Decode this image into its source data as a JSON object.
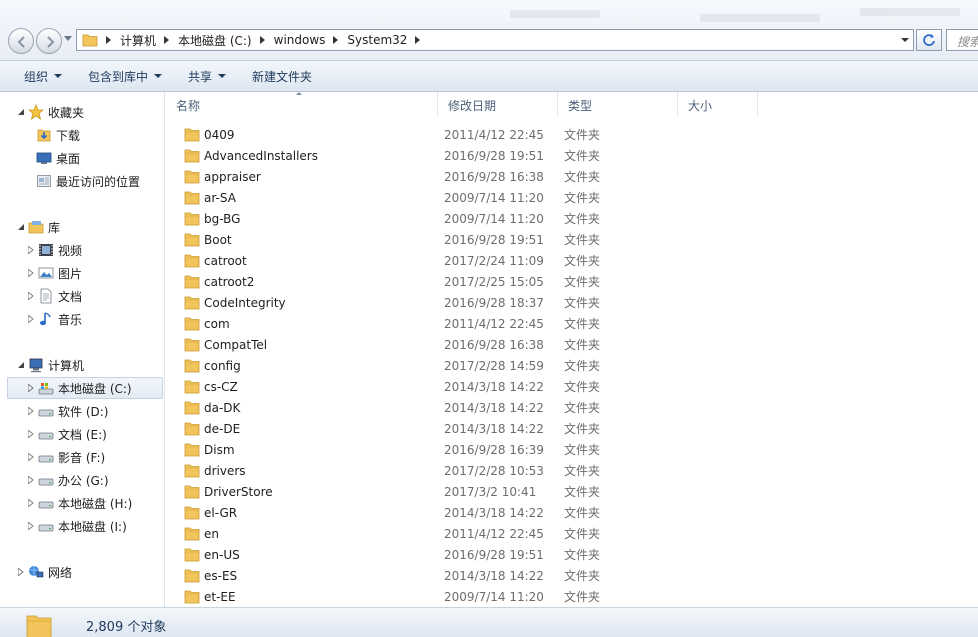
{
  "address": {
    "crumbs": [
      "计算机",
      "本地磁盘 (C:)",
      "windows",
      "System32"
    ],
    "search_placeholder": "搜索"
  },
  "toolbar": {
    "organize": "组织",
    "include": "包含到库中",
    "share": "共享",
    "new_folder": "新建文件夹"
  },
  "nav": {
    "favorites": "收藏夹",
    "downloads": "下载",
    "desktop": "桌面",
    "recent": "最近访问的位置",
    "libraries": "库",
    "videos": "视频",
    "pictures": "图片",
    "documents": "文档",
    "music": "音乐",
    "computer": "计算机",
    "drives": [
      "本地磁盘 (C:)",
      "软件 (D:)",
      "文档 (E:)",
      "影音 (F:)",
      "办公 (G:)",
      "本地磁盘 (H:)",
      "本地磁盘 (I:)"
    ],
    "network": "网络"
  },
  "columns": {
    "name": "名称",
    "date": "修改日期",
    "type": "类型",
    "size": "大小"
  },
  "files": [
    {
      "name": "0409",
      "date": "2011/4/12 22:45",
      "type": "文件夹"
    },
    {
      "name": "AdvancedInstallers",
      "date": "2016/9/28 19:51",
      "type": "文件夹"
    },
    {
      "name": "appraiser",
      "date": "2016/9/28 16:38",
      "type": "文件夹"
    },
    {
      "name": "ar-SA",
      "date": "2009/7/14 11:20",
      "type": "文件夹"
    },
    {
      "name": "bg-BG",
      "date": "2009/7/14 11:20",
      "type": "文件夹"
    },
    {
      "name": "Boot",
      "date": "2016/9/28 19:51",
      "type": "文件夹"
    },
    {
      "name": "catroot",
      "date": "2017/2/24 11:09",
      "type": "文件夹"
    },
    {
      "name": "catroot2",
      "date": "2017/2/25 15:05",
      "type": "文件夹"
    },
    {
      "name": "CodeIntegrity",
      "date": "2016/9/28 18:37",
      "type": "文件夹"
    },
    {
      "name": "com",
      "date": "2011/4/12 22:45",
      "type": "文件夹"
    },
    {
      "name": "CompatTel",
      "date": "2016/9/28 16:38",
      "type": "文件夹"
    },
    {
      "name": "config",
      "date": "2017/2/28 14:59",
      "type": "文件夹"
    },
    {
      "name": "cs-CZ",
      "date": "2014/3/18 14:22",
      "type": "文件夹"
    },
    {
      "name": "da-DK",
      "date": "2014/3/18 14:22",
      "type": "文件夹"
    },
    {
      "name": "de-DE",
      "date": "2014/3/18 14:22",
      "type": "文件夹"
    },
    {
      "name": "Dism",
      "date": "2016/9/28 16:39",
      "type": "文件夹"
    },
    {
      "name": "drivers",
      "date": "2017/2/28 10:53",
      "type": "文件夹"
    },
    {
      "name": "DriverStore",
      "date": "2017/3/2 10:41",
      "type": "文件夹"
    },
    {
      "name": "el-GR",
      "date": "2014/3/18 14:22",
      "type": "文件夹"
    },
    {
      "name": "en",
      "date": "2011/4/12 22:45",
      "type": "文件夹"
    },
    {
      "name": "en-US",
      "date": "2016/9/28 19:51",
      "type": "文件夹"
    },
    {
      "name": "es-ES",
      "date": "2014/3/18 14:22",
      "type": "文件夹"
    },
    {
      "name": "et-EE",
      "date": "2009/7/14 11:20",
      "type": "文件夹"
    }
  ],
  "status": {
    "count": "2,809 个对象"
  },
  "colors": {
    "folder": "#f2c55c",
    "folder_dark": "#d9a531",
    "selection": "#e4ebf4",
    "toolbar_text": "#1e395b"
  }
}
